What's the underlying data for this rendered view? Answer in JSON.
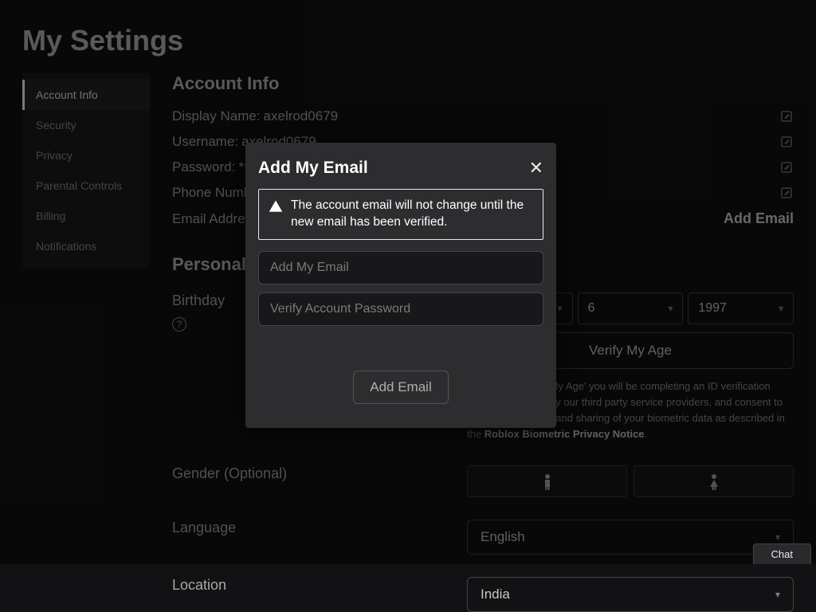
{
  "page_title": "My Settings",
  "sidebar": {
    "items": [
      {
        "label": "Account Info"
      },
      {
        "label": "Security"
      },
      {
        "label": "Privacy"
      },
      {
        "label": "Parental Controls"
      },
      {
        "label": "Billing"
      },
      {
        "label": "Notifications"
      }
    ]
  },
  "account": {
    "section_title": "Account Info",
    "display_name_label": "Display Name:",
    "display_name_value": "axelrod0679",
    "username_label": "Username:",
    "username_value": "axelrod0679",
    "password_label": "Password:",
    "password_value": "********",
    "phone_label": "Phone Number:",
    "email_label": "Email Address:",
    "add_email_link": "Add Email"
  },
  "personal": {
    "section_title": "Personal",
    "birthday_label": "Birthday",
    "birthday_day": "6",
    "birthday_year": "1997",
    "verify_age_btn": "Verify My Age",
    "biometric_text_part1": "By clicking 'Verify My Age' you will be completing an ID verification process operated by our third party service providers, and consent to the collection, use, and sharing of your biometric data as described in the ",
    "biometric_link": "Roblox Biometric Privacy Notice",
    "biometric_text_part2": ".",
    "gender_label": "Gender (Optional)",
    "language_label": "Language",
    "language_value": "English",
    "location_label": "Location",
    "location_value": "India"
  },
  "modal": {
    "title": "Add My Email",
    "warning": "The account email will not change until the new email has been verified.",
    "email_placeholder": "Add My Email",
    "password_placeholder": "Verify Account Password",
    "submit": "Add Email"
  },
  "chat_label": "Chat"
}
